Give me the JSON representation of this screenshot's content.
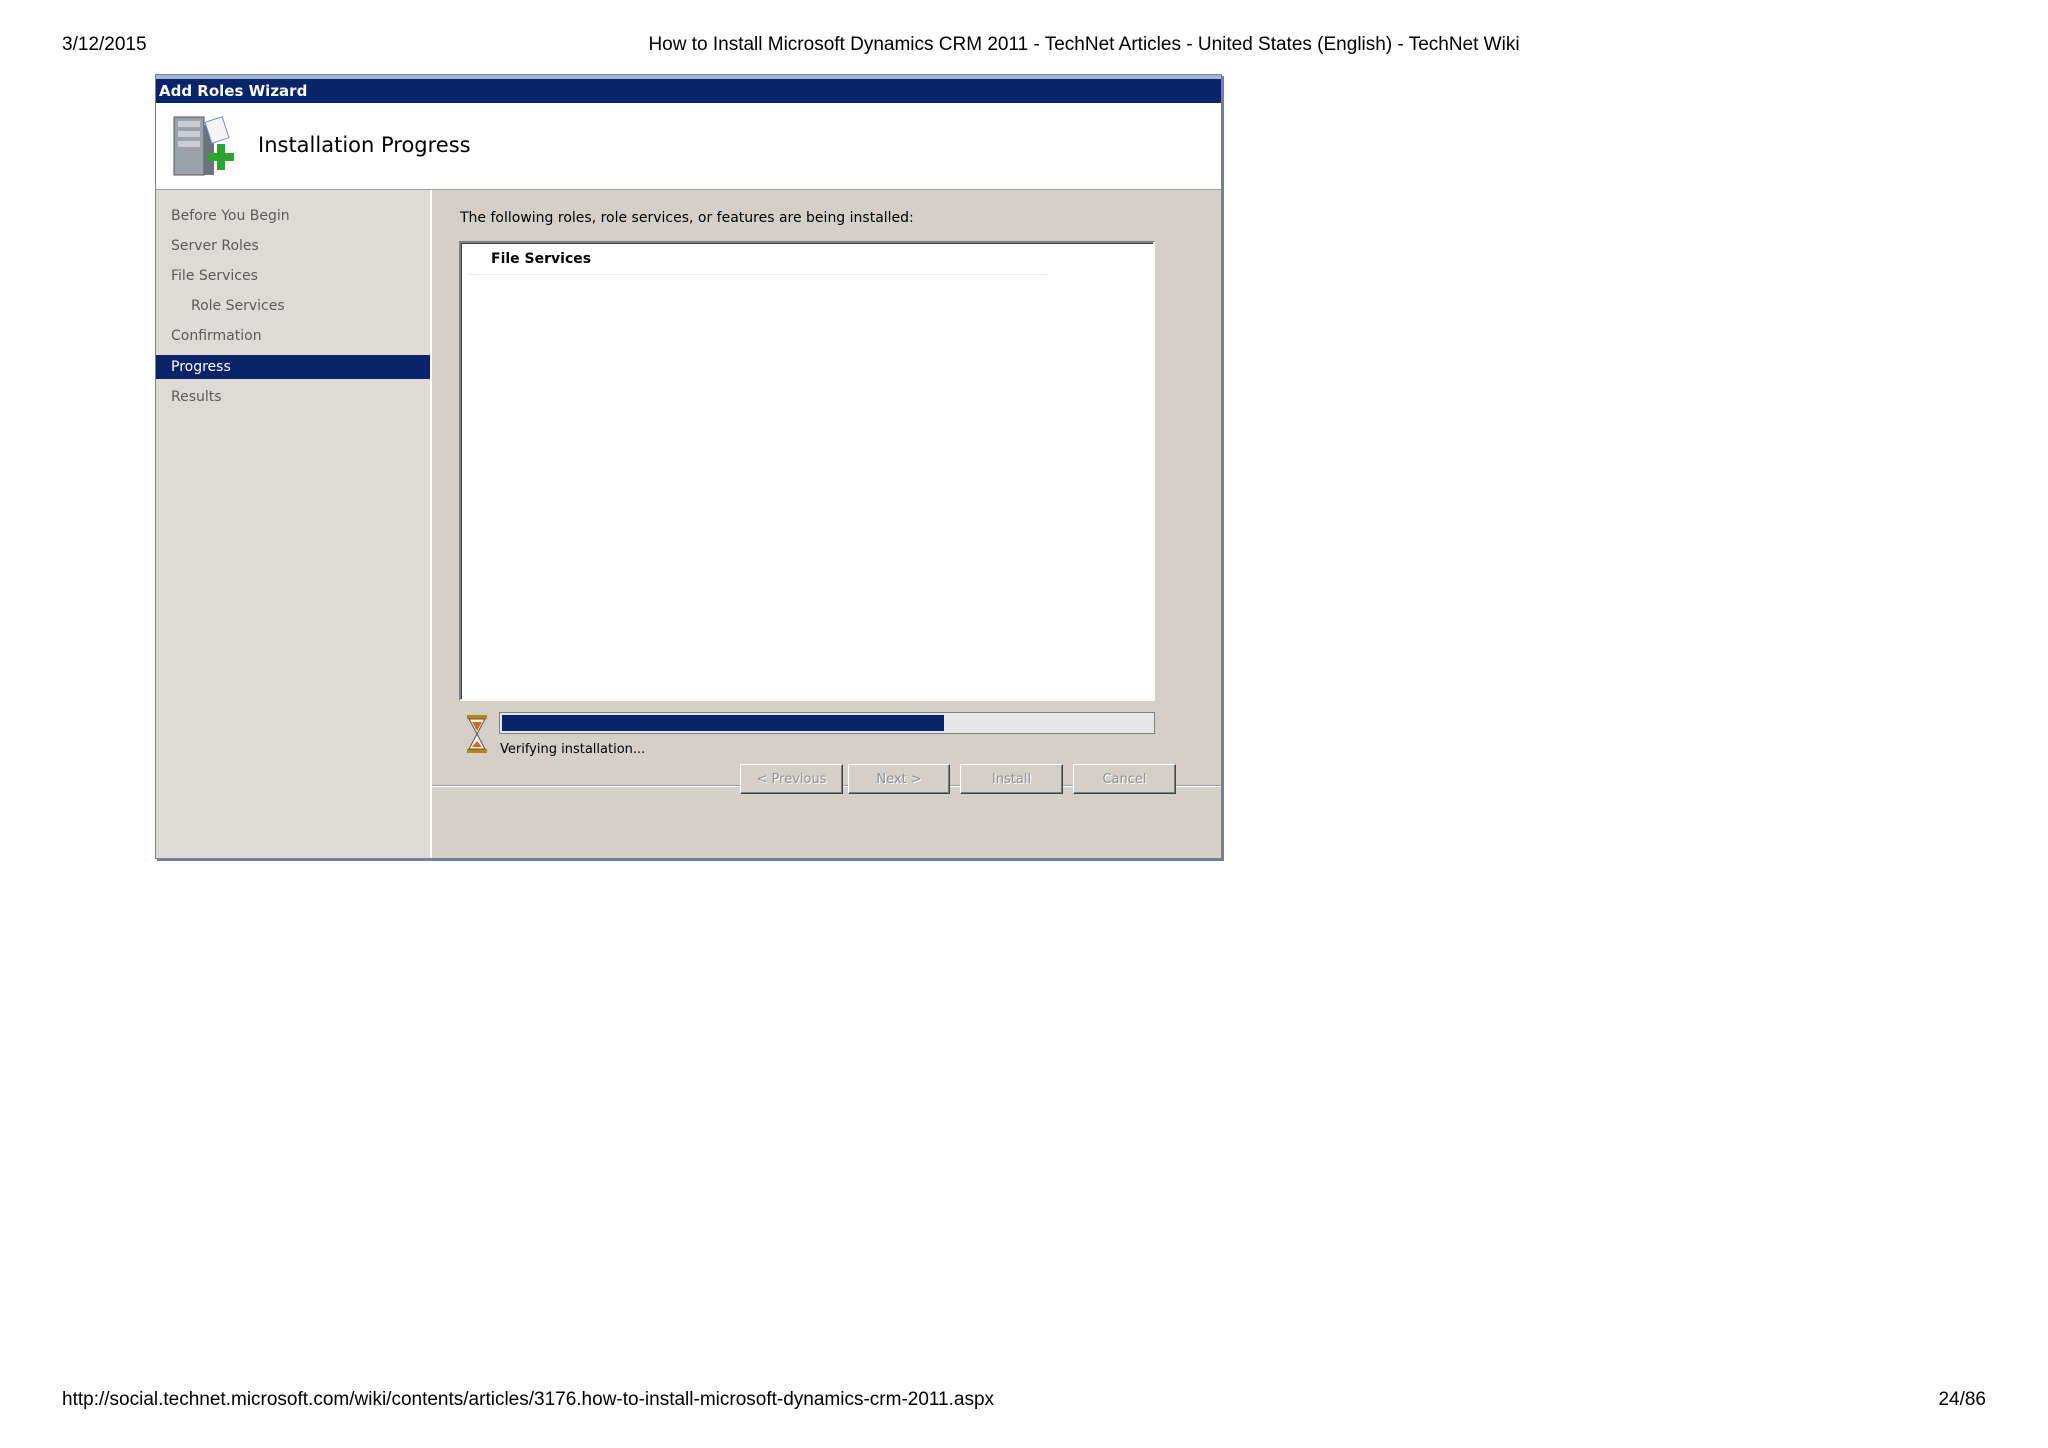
{
  "page_header": {
    "date": "3/12/2015",
    "title": "How to Install Microsoft Dynamics CRM 2011 - TechNet Articles - United States (English) - TechNet Wiki"
  },
  "page_footer": {
    "url": "http://social.technet.microsoft.com/wiki/contents/articles/3176.how-to-install-microsoft-dynamics-crm-2011.aspx",
    "page": "24/86"
  },
  "wizard": {
    "window_title": "Add Roles Wizard",
    "header_title": "Installation Progress",
    "header_icon": "server-add-icon",
    "nav": [
      {
        "label": "Before You Begin",
        "active": false
      },
      {
        "label": "Server Roles",
        "active": false
      },
      {
        "label": "File Services",
        "active": false
      },
      {
        "label": "Role Services",
        "active": false,
        "sub": true
      },
      {
        "label": "Confirmation",
        "active": false
      },
      {
        "label": "Progress",
        "active": true
      },
      {
        "label": "Results",
        "active": false
      }
    ],
    "intro": "The following roles, role services, or features are being installed:",
    "list_items": [
      "File Services"
    ],
    "progress": {
      "fraction": 0.68,
      "status": "Verifying installation..."
    },
    "buttons": {
      "previous": "< Previous",
      "next": "Next >",
      "install": "Install",
      "cancel": "Cancel"
    },
    "colors": {
      "titlebar": "#0a246a",
      "progress_fill": "#0a246a",
      "dialog_bg": "#d4d0c8"
    }
  }
}
